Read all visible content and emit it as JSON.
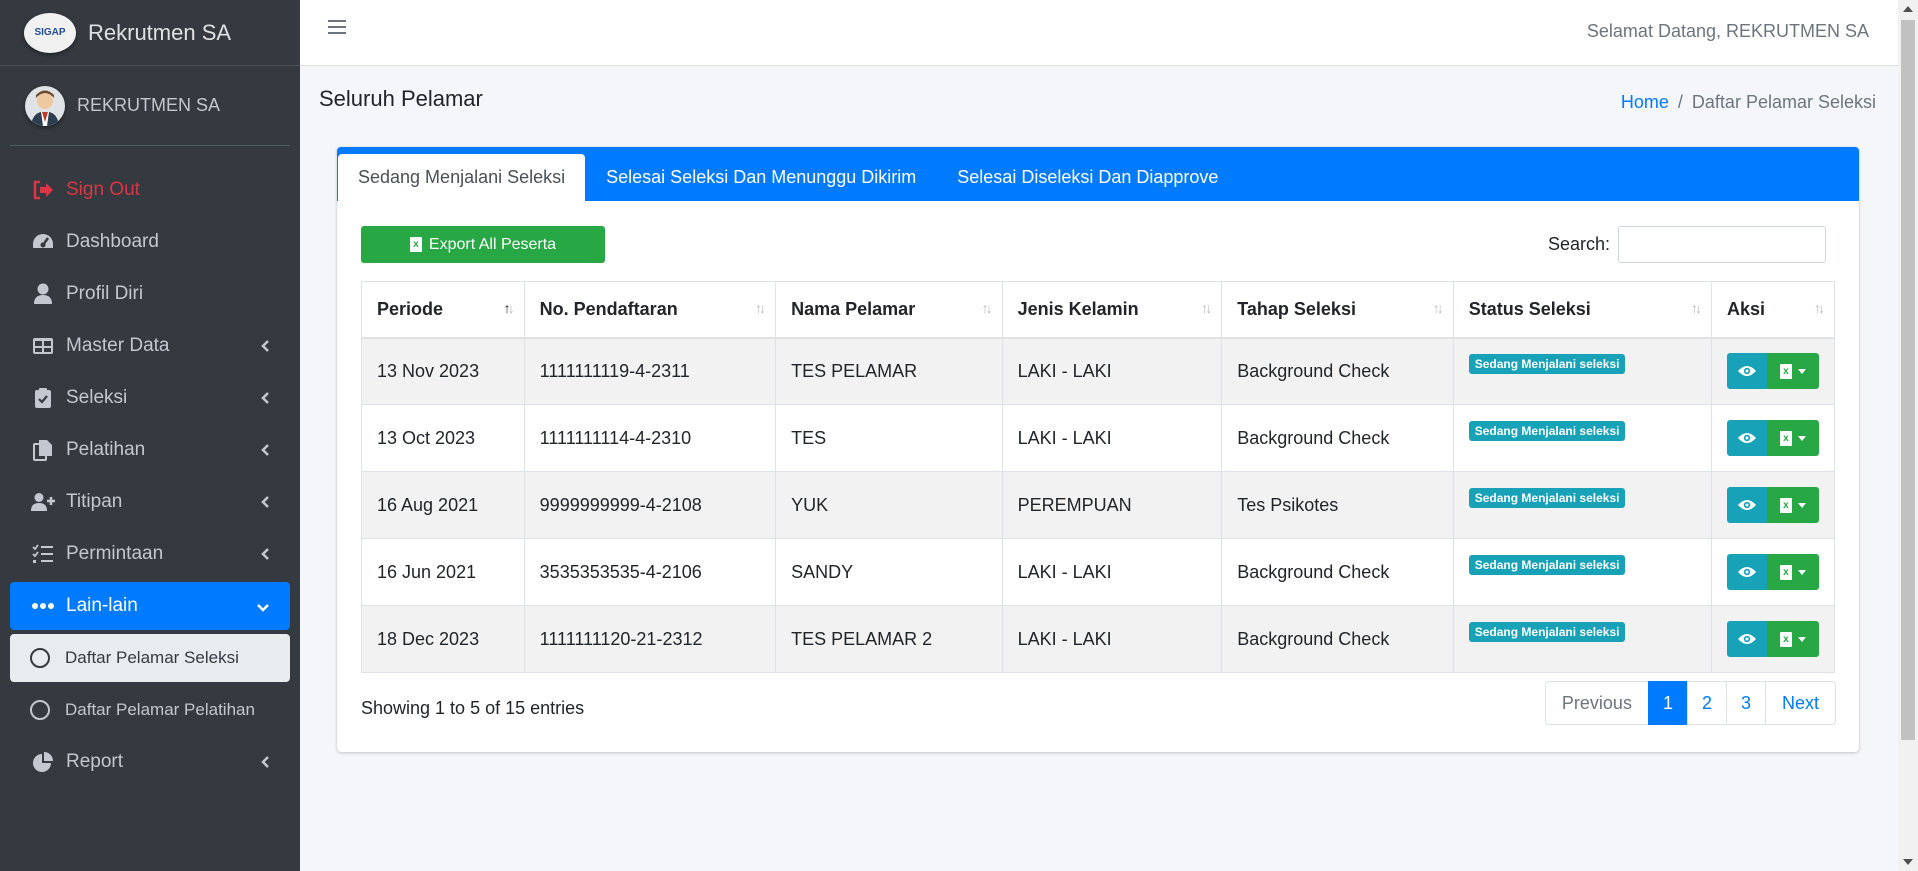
{
  "brand": {
    "title": "Rekrutmen SA",
    "logo_text": "SIGAP"
  },
  "user": {
    "name": "REKRUTMEN SA"
  },
  "nav": {
    "items": [
      {
        "label": "Sign Out",
        "icon": "sign-out-icon"
      },
      {
        "label": "Dashboard",
        "icon": "dashboard-icon"
      },
      {
        "label": "Profil Diri",
        "icon": "user-icon"
      },
      {
        "label": "Master Data",
        "icon": "table-icon"
      },
      {
        "label": "Seleksi",
        "icon": "clipboard-check-icon"
      },
      {
        "label": "Pelatihan",
        "icon": "copy-icon"
      },
      {
        "label": "Titipan",
        "icon": "user-plus-icon"
      },
      {
        "label": "Permintaan",
        "icon": "list-check-icon"
      },
      {
        "label": "Lain-lain",
        "icon": "ellipsis-icon"
      }
    ],
    "subitems": [
      {
        "label": "Daftar Pelamar Seleksi"
      },
      {
        "label": "Daftar Pelamar Pelatihan"
      }
    ],
    "report": {
      "label": "Report",
      "icon": "pie-chart-icon"
    }
  },
  "topbar": {
    "welcome": "Selamat Datang, REKRUTMEN SA"
  },
  "page": {
    "title": "Seluruh Pelamar"
  },
  "breadcrumb": {
    "home": "Home",
    "sep": "/",
    "current": "Daftar Pelamar Seleksi"
  },
  "tabs": [
    {
      "label": "Sedang Menjalani Seleksi"
    },
    {
      "label": "Selesai Seleksi Dan Menunggu Dikirim"
    },
    {
      "label": "Selesai Diseleksi Dan Diapprove"
    }
  ],
  "toolbar": {
    "export_label": "Export All Peserta",
    "search_label": "Search:",
    "search_value": ""
  },
  "table": {
    "headers": [
      "Periode",
      "No. Pendaftaran",
      "Nama Pelamar",
      "Jenis Kelamin",
      "Tahap Seleksi",
      "Status Seleksi",
      "Aksi"
    ],
    "rows": [
      {
        "periode": "13 Nov 2023",
        "no": "1111111119-4-2311",
        "nama": "TES PELAMAR",
        "jk": "LAKI - LAKI",
        "tahap": "Background Check",
        "status": "Sedang Menjalani seleksi"
      },
      {
        "periode": "13 Oct 2023",
        "no": "1111111114-4-2310",
        "nama": "TES",
        "jk": "LAKI - LAKI",
        "tahap": "Background Check",
        "status": "Sedang Menjalani seleksi"
      },
      {
        "periode": "16 Aug 2021",
        "no": "9999999999-4-2108",
        "nama": "YUK",
        "jk": "PEREMPUAN",
        "tahap": "Tes Psikotes",
        "status": "Sedang Menjalani seleksi"
      },
      {
        "periode": "16 Jun 2021",
        "no": "3535353535-4-2106",
        "nama": "SANDY",
        "jk": "LAKI - LAKI",
        "tahap": "Background Check",
        "status": "Sedang Menjalani seleksi"
      },
      {
        "periode": "18 Dec 2023",
        "no": "1111111120-21-2312",
        "nama": "TES PELAMAR 2",
        "jk": "LAKI - LAKI",
        "tahap": "Background Check",
        "status": "Sedang Menjalani seleksi"
      }
    ]
  },
  "footer": {
    "info": "Showing 1 to 5 of 15 entries",
    "pagination": {
      "previous": "Previous",
      "pages": [
        "1",
        "2",
        "3"
      ],
      "next": "Next"
    }
  },
  "colors": {
    "primary": "#007bff",
    "success": "#28a745",
    "info": "#17a2b8",
    "danger": "#dc3545",
    "sidebar": "#343a40"
  }
}
